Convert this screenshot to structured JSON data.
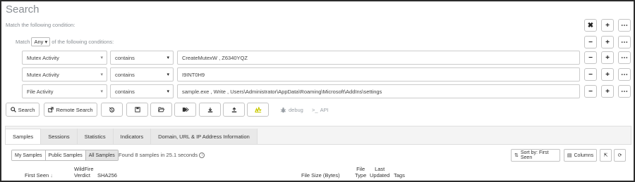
{
  "page": {
    "title": "Search",
    "match_first_label": "Match the following condition:",
    "match_prefix": "Match",
    "match_value": "Any",
    "match_suffix": "of the following conditions:"
  },
  "conditions": [
    {
      "field": "Mutex Activity",
      "operator": "contains",
      "value": "CreateMutexW , Z6340YQZ"
    },
    {
      "field": "Mutex Activity",
      "operator": "contains",
      "value": "I9INT0H9"
    },
    {
      "field": "File Activity",
      "operator": "contains",
      "value": "sample.exe , Write , Users\\Administrator\\AppData\\Roaming\\Microsoft\\AddIns\\settings"
    }
  ],
  "toolbar": {
    "search_label": "Search",
    "remote_search_label": "Remote Search",
    "debug_label": "debug",
    "api_label": "API"
  },
  "tabs": [
    "Samples",
    "Sessions",
    "Statistics",
    "Indicators",
    "Domain, URL & IP Address Information"
  ],
  "filters": [
    "My Samples",
    "Public Samples",
    "All Samples"
  ],
  "results_text": "Found 8 samples in 25.1 seconds",
  "sort_label": "Sort by: First Seen",
  "columns_label": "Columns",
  "table_headers": {
    "first_seen": "First Seen",
    "wildfire": "WildFire",
    "verdict": "Verdict",
    "sha256": "SHA256",
    "file_size": "File Size (Bytes)",
    "file": "File",
    "type": "Type",
    "last": "Last",
    "updated": "Updated",
    "tags": "Tags"
  },
  "colors": {
    "accent_yellow": "#c9c900",
    "border": "#c4c4c4",
    "muted": "#8a8f94"
  }
}
